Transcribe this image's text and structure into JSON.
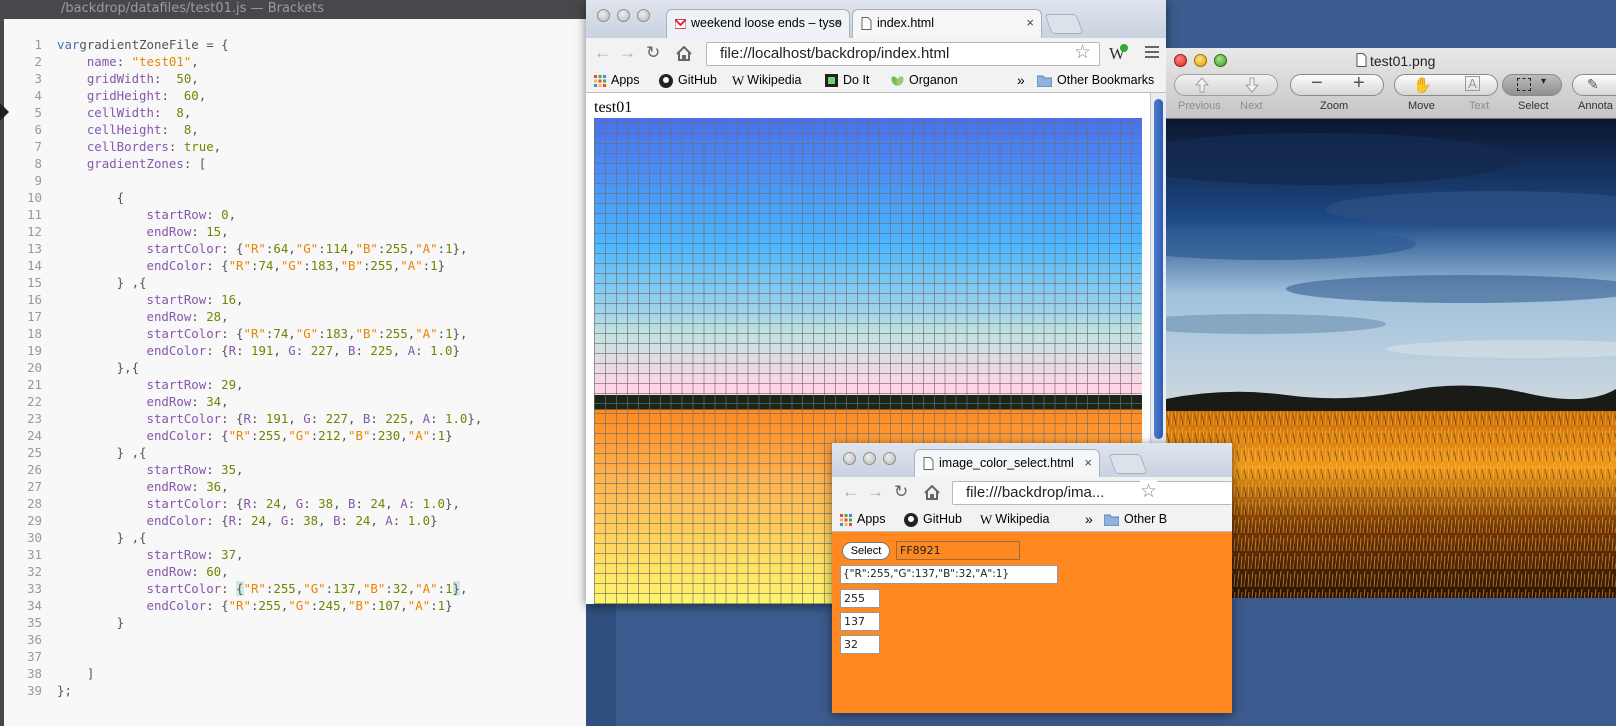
{
  "brackets": {
    "title": "/backdrop/datafiles/test01.js — Brackets",
    "lines": [
      {
        "n": "1",
        "t": [
          [
            "k",
            "var"
          ],
          [
            "",
            "gradientZoneFile = {"
          ]
        ]
      },
      {
        "n": "2",
        "t": [
          [
            "p",
            "    name"
          ],
          [
            "",
            ": "
          ],
          [
            "s",
            "\"test01\""
          ],
          [
            "",
            ","
          ]
        ]
      },
      {
        "n": "3",
        "t": [
          [
            "p",
            "    gridWidth"
          ],
          [
            "",
            ":  "
          ],
          [
            "n",
            "50"
          ],
          [
            "",
            ","
          ]
        ]
      },
      {
        "n": "4",
        "t": [
          [
            "p",
            "    gridHeight"
          ],
          [
            "",
            ":  "
          ],
          [
            "n",
            "60"
          ],
          [
            "",
            ","
          ]
        ]
      },
      {
        "n": "5",
        "t": [
          [
            "p",
            "    cellWidth"
          ],
          [
            "",
            ":  "
          ],
          [
            "n",
            "8"
          ],
          [
            "",
            ","
          ]
        ]
      },
      {
        "n": "6",
        "t": [
          [
            "p",
            "    cellHeight"
          ],
          [
            "",
            ":  "
          ],
          [
            "n",
            "8"
          ],
          [
            "",
            ","
          ]
        ]
      },
      {
        "n": "7",
        "t": [
          [
            "p",
            "    cellBorders"
          ],
          [
            "",
            ": "
          ],
          [
            "b",
            "true"
          ],
          [
            "",
            ","
          ]
        ]
      },
      {
        "n": "8",
        "t": [
          [
            "p",
            "    gradientZones"
          ],
          [
            "",
            ": ["
          ]
        ]
      },
      {
        "n": "9",
        "t": []
      },
      {
        "n": "10",
        "t": [
          [
            "",
            "        {"
          ]
        ]
      },
      {
        "n": "11",
        "t": [
          [
            "p",
            "            startRow"
          ],
          [
            "",
            ": "
          ],
          [
            "n",
            "0"
          ],
          [
            "",
            ","
          ]
        ]
      },
      {
        "n": "12",
        "t": [
          [
            "p",
            "            endRow"
          ],
          [
            "",
            ": "
          ],
          [
            "n",
            "15"
          ],
          [
            "",
            ","
          ]
        ]
      },
      {
        "n": "13",
        "t": [
          [
            "p",
            "            startColor"
          ],
          [
            "",
            ": {"
          ],
          [
            "s",
            "\"R\""
          ],
          [
            "",
            ":"
          ],
          [
            "n",
            "64"
          ],
          [
            "",
            ","
          ],
          [
            "s",
            "\"G\""
          ],
          [
            "",
            ":"
          ],
          [
            "n",
            "114"
          ],
          [
            "",
            ","
          ],
          [
            "s",
            "\"B\""
          ],
          [
            "",
            ":"
          ],
          [
            "n",
            "255"
          ],
          [
            "",
            ","
          ],
          [
            "s",
            "\"A\""
          ],
          [
            "",
            ":"
          ],
          [
            "n",
            "1"
          ],
          [
            "",
            "},"
          ]
        ]
      },
      {
        "n": "14",
        "t": [
          [
            "p",
            "            endColor"
          ],
          [
            "",
            ": {"
          ],
          [
            "s",
            "\"R\""
          ],
          [
            "",
            ":"
          ],
          [
            "n",
            "74"
          ],
          [
            "",
            ","
          ],
          [
            "s",
            "\"G\""
          ],
          [
            "",
            ":"
          ],
          [
            "n",
            "183"
          ],
          [
            "",
            ","
          ],
          [
            "s",
            "\"B\""
          ],
          [
            "",
            ":"
          ],
          [
            "n",
            "255"
          ],
          [
            "",
            ","
          ],
          [
            "s",
            "\"A\""
          ],
          [
            "",
            ":"
          ],
          [
            "n",
            "1"
          ],
          [
            "",
            "}"
          ]
        ]
      },
      {
        "n": "15",
        "t": [
          [
            "",
            "        } ,{"
          ]
        ]
      },
      {
        "n": "16",
        "t": [
          [
            "p",
            "            startRow"
          ],
          [
            "",
            ": "
          ],
          [
            "n",
            "16"
          ],
          [
            "",
            ","
          ]
        ]
      },
      {
        "n": "17",
        "t": [
          [
            "p",
            "            endRow"
          ],
          [
            "",
            ": "
          ],
          [
            "n",
            "28"
          ],
          [
            "",
            ","
          ]
        ]
      },
      {
        "n": "18",
        "t": [
          [
            "p",
            "            startColor"
          ],
          [
            "",
            ": {"
          ],
          [
            "s",
            "\"R\""
          ],
          [
            "",
            ":"
          ],
          [
            "n",
            "74"
          ],
          [
            "",
            ","
          ],
          [
            "s",
            "\"G\""
          ],
          [
            "",
            ":"
          ],
          [
            "n",
            "183"
          ],
          [
            "",
            ","
          ],
          [
            "s",
            "\"B\""
          ],
          [
            "",
            ":"
          ],
          [
            "n",
            "255"
          ],
          [
            "",
            ","
          ],
          [
            "s",
            "\"A\""
          ],
          [
            "",
            ":"
          ],
          [
            "n",
            "1"
          ],
          [
            "",
            "},"
          ]
        ]
      },
      {
        "n": "19",
        "t": [
          [
            "p",
            "            endColor"
          ],
          [
            "",
            ": {"
          ],
          [
            "p",
            "R"
          ],
          [
            "",
            ": "
          ],
          [
            "n",
            "191"
          ],
          [
            "",
            ", "
          ],
          [
            "p",
            "G"
          ],
          [
            "",
            ": "
          ],
          [
            "n",
            "227"
          ],
          [
            "",
            ", "
          ],
          [
            "p",
            "B"
          ],
          [
            "",
            ": "
          ],
          [
            "n",
            "225"
          ],
          [
            "",
            ", "
          ],
          [
            "p",
            "A"
          ],
          [
            "",
            ": "
          ],
          [
            "n",
            "1.0"
          ],
          [
            "",
            "}"
          ]
        ]
      },
      {
        "n": "20",
        "t": [
          [
            "",
            "        },{"
          ]
        ]
      },
      {
        "n": "21",
        "t": [
          [
            "p",
            "            startRow"
          ],
          [
            "",
            ": "
          ],
          [
            "n",
            "29"
          ],
          [
            "",
            ","
          ]
        ]
      },
      {
        "n": "22",
        "t": [
          [
            "p",
            "            endRow"
          ],
          [
            "",
            ": "
          ],
          [
            "n",
            "34"
          ],
          [
            "",
            ","
          ]
        ]
      },
      {
        "n": "23",
        "t": [
          [
            "p",
            "            startColor"
          ],
          [
            "",
            ": {"
          ],
          [
            "p",
            "R"
          ],
          [
            "",
            ": "
          ],
          [
            "n",
            "191"
          ],
          [
            "",
            ", "
          ],
          [
            "p",
            "G"
          ],
          [
            "",
            ": "
          ],
          [
            "n",
            "227"
          ],
          [
            "",
            ", "
          ],
          [
            "p",
            "B"
          ],
          [
            "",
            ": "
          ],
          [
            "n",
            "225"
          ],
          [
            "",
            ", "
          ],
          [
            "p",
            "A"
          ],
          [
            "",
            ": "
          ],
          [
            "n",
            "1.0"
          ],
          [
            "",
            "},"
          ]
        ]
      },
      {
        "n": "24",
        "t": [
          [
            "p",
            "            endColor"
          ],
          [
            "",
            ": {"
          ],
          [
            "s",
            "\"R\""
          ],
          [
            "",
            ":"
          ],
          [
            "n",
            "255"
          ],
          [
            "",
            ","
          ],
          [
            "s",
            "\"G\""
          ],
          [
            "",
            ":"
          ],
          [
            "n",
            "212"
          ],
          [
            "",
            ","
          ],
          [
            "s",
            "\"B\""
          ],
          [
            "",
            ":"
          ],
          [
            "n",
            "230"
          ],
          [
            "",
            ","
          ],
          [
            "s",
            "\"A\""
          ],
          [
            "",
            ":"
          ],
          [
            "n",
            "1"
          ],
          [
            "",
            "}"
          ]
        ]
      },
      {
        "n": "25",
        "t": [
          [
            "",
            "        } ,{"
          ]
        ]
      },
      {
        "n": "26",
        "t": [
          [
            "p",
            "            startRow"
          ],
          [
            "",
            ": "
          ],
          [
            "n",
            "35"
          ],
          [
            "",
            ","
          ]
        ]
      },
      {
        "n": "27",
        "t": [
          [
            "p",
            "            endRow"
          ],
          [
            "",
            ": "
          ],
          [
            "n",
            "36"
          ],
          [
            "",
            ","
          ]
        ]
      },
      {
        "n": "28",
        "t": [
          [
            "p",
            "            startColor"
          ],
          [
            "",
            ": {"
          ],
          [
            "p",
            "R"
          ],
          [
            "",
            ": "
          ],
          [
            "n",
            "24"
          ],
          [
            "",
            ", "
          ],
          [
            "p",
            "G"
          ],
          [
            "",
            ": "
          ],
          [
            "n",
            "38"
          ],
          [
            "",
            ", "
          ],
          [
            "p",
            "B"
          ],
          [
            "",
            ": "
          ],
          [
            "n",
            "24"
          ],
          [
            "",
            ", "
          ],
          [
            "p",
            "A"
          ],
          [
            "",
            ": "
          ],
          [
            "n",
            "1.0"
          ],
          [
            "",
            "},"
          ]
        ]
      },
      {
        "n": "29",
        "t": [
          [
            "p",
            "            endColor"
          ],
          [
            "",
            ": {"
          ],
          [
            "p",
            "R"
          ],
          [
            "",
            ": "
          ],
          [
            "n",
            "24"
          ],
          [
            "",
            ", "
          ],
          [
            "p",
            "G"
          ],
          [
            "",
            ": "
          ],
          [
            "n",
            "38"
          ],
          [
            "",
            ", "
          ],
          [
            "p",
            "B"
          ],
          [
            "",
            ": "
          ],
          [
            "n",
            "24"
          ],
          [
            "",
            ", "
          ],
          [
            "p",
            "A"
          ],
          [
            "",
            ": "
          ],
          [
            "n",
            "1.0"
          ],
          [
            "",
            "}"
          ]
        ]
      },
      {
        "n": "30",
        "t": [
          [
            "",
            "        } ,{"
          ]
        ]
      },
      {
        "n": "31",
        "t": [
          [
            "p",
            "            startRow"
          ],
          [
            "",
            ": "
          ],
          [
            "n",
            "37"
          ],
          [
            "",
            ","
          ]
        ]
      },
      {
        "n": "32",
        "t": [
          [
            "p",
            "            endRow"
          ],
          [
            "",
            ": "
          ],
          [
            "n",
            "60"
          ],
          [
            "",
            ","
          ]
        ]
      },
      {
        "n": "33",
        "t": [
          [
            "p",
            "            startColor"
          ],
          [
            "",
            ": "
          ],
          [
            "hl",
            "{"
          ],
          [
            "s",
            "\"R\""
          ],
          [
            "",
            ":"
          ],
          [
            "n",
            "255"
          ],
          [
            "",
            ","
          ],
          [
            "s",
            "\"G\""
          ],
          [
            "",
            ":"
          ],
          [
            "n",
            "137"
          ],
          [
            "",
            ","
          ],
          [
            "s",
            "\"B\""
          ],
          [
            "",
            ":"
          ],
          [
            "n",
            "32"
          ],
          [
            "",
            ","
          ],
          [
            "s",
            "\"A\""
          ],
          [
            "",
            ":"
          ],
          [
            "n",
            "1"
          ],
          [
            "hl",
            "}"
          ],
          [
            "",
            ","
          ]
        ]
      },
      {
        "n": "34",
        "t": [
          [
            "p",
            "            endColor"
          ],
          [
            "",
            ": {"
          ],
          [
            "s",
            "\"R\""
          ],
          [
            "",
            ":"
          ],
          [
            "n",
            "255"
          ],
          [
            "",
            ","
          ],
          [
            "s",
            "\"G\""
          ],
          [
            "",
            ":"
          ],
          [
            "n",
            "245"
          ],
          [
            "",
            ","
          ],
          [
            "s",
            "\"B\""
          ],
          [
            "",
            ":"
          ],
          [
            "n",
            "107"
          ],
          [
            "",
            ","
          ],
          [
            "s",
            "\"A\""
          ],
          [
            "",
            ":"
          ],
          [
            "n",
            "1"
          ],
          [
            "",
            "}"
          ]
        ]
      },
      {
        "n": "35",
        "t": [
          [
            "",
            "        }"
          ]
        ]
      },
      {
        "n": "36",
        "t": []
      },
      {
        "n": "37",
        "t": []
      },
      {
        "n": "38",
        "t": [
          [
            "",
            "    ]"
          ]
        ]
      },
      {
        "n": "39",
        "t": [
          [
            "",
            "};"
          ]
        ]
      }
    ]
  },
  "chrome_main": {
    "tabs": [
      {
        "label": "weekend loose ends – tyso",
        "close": "×",
        "icon": "gmail-icon"
      },
      {
        "label": "index.html",
        "close": "×",
        "icon": "page-icon"
      }
    ],
    "url": "file://localhost/backdrop/index.html",
    "bookmarks": [
      {
        "label": "Apps",
        "icon": "apps-icon"
      },
      {
        "label": "GitHub",
        "icon": "github-icon"
      },
      {
        "label": "Wikipedia",
        "icon": "wikipedia-icon"
      },
      {
        "label": "Do It",
        "icon": "film-icon"
      },
      {
        "label": "Organon",
        "icon": "leaf-icon"
      }
    ],
    "overflow": "»",
    "other_bookmarks": "Other Bookmarks",
    "page_title": "test01"
  },
  "preview": {
    "title": "test01.png",
    "tools": [
      {
        "label": "Previous",
        "dim": true
      },
      {
        "label": "Next",
        "dim": true
      },
      {
        "label": "Zoom",
        "dim": false
      },
      {
        "label": "Move",
        "dim": false
      },
      {
        "label": "Text",
        "dim": true
      },
      {
        "label": "Select",
        "dim": false
      },
      {
        "label": "Annota",
        "dim": false
      }
    ]
  },
  "picker": {
    "tab_label": "image_color_select.html",
    "tab_close": "×",
    "url": "file:///backdrop/ima...",
    "bookmarks": [
      "Apps",
      "GitHub",
      "Wikipedia"
    ],
    "overflow": "»",
    "other_bookmarks": "Other B",
    "select_label": "Select",
    "hex_value": "FF8921",
    "json_value": "{\"R\":255,\"G\":137,\"B\":32,\"A\":1}",
    "r_value": "255",
    "g_value": "137",
    "b_value": "32"
  },
  "colors": {
    "picked": "#ff8920",
    "desktop": "#3c5b8e"
  }
}
